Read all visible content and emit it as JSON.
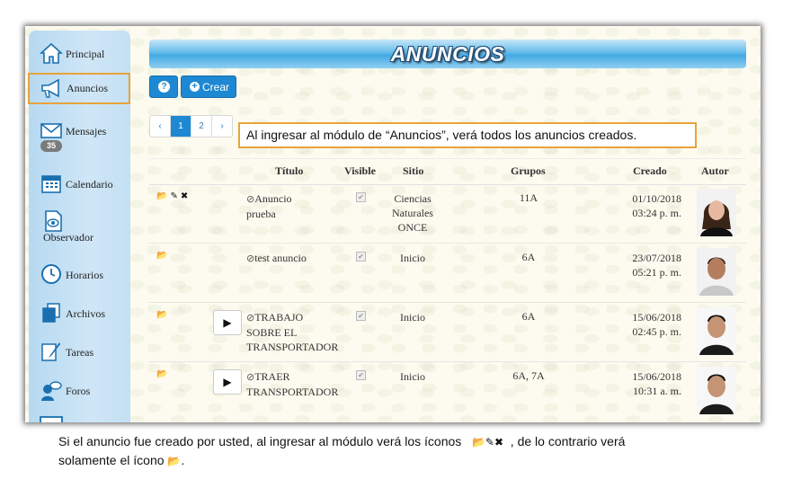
{
  "sidebar": {
    "items": [
      {
        "label": "Principal",
        "icon": "home-icon"
      },
      {
        "label": "Anuncios",
        "icon": "megaphone-icon"
      },
      {
        "label": "Mensajes",
        "icon": "envelope-icon",
        "badge": "35"
      },
      {
        "label": "Calendario",
        "icon": "calendar-icon"
      },
      {
        "label": "Observador",
        "icon": "eye-document-icon"
      },
      {
        "label": "Horarios",
        "icon": "clock-icon"
      },
      {
        "label": "Archivos",
        "icon": "files-icon"
      },
      {
        "label": "Tareas",
        "icon": "pencil-paper-icon"
      },
      {
        "label": "Foros",
        "icon": "forum-icon"
      }
    ]
  },
  "header": {
    "title": "ANUNCIOS"
  },
  "toolbar": {
    "help_label": "?",
    "create_label": "Crear"
  },
  "pager": {
    "prev": "‹",
    "pages": [
      "1",
      "2"
    ],
    "next": "›",
    "active": "1"
  },
  "callout": "Al ingresar al módulo de “Anuncios”, verá todos los anuncios creados.",
  "table": {
    "columns": [
      "Título",
      "Visible",
      "Sitio",
      "Grupos",
      "Creado",
      "Autor"
    ],
    "rows": [
      {
        "title_lines": [
          "Anuncio",
          "prueba"
        ],
        "sitio_lines": [
          "Ciencias",
          "Naturales",
          "ONCE"
        ],
        "grupos": "11A",
        "fecha": "01/10/2018",
        "hora": "03:24 p. m.",
        "actions": "full",
        "play": false
      },
      {
        "title_lines": [
          "test anuncio"
        ],
        "sitio_lines": [
          "Inicio"
        ],
        "grupos": "6A",
        "fecha": "23/07/2018",
        "hora": "05:21 p. m.",
        "actions": "folder",
        "play": false
      },
      {
        "title_lines": [
          "TRABAJO",
          "SOBRE EL",
          "TRANSPORTADOR"
        ],
        "sitio_lines": [
          "Inicio"
        ],
        "grupos": "6A",
        "fecha": "15/06/2018",
        "hora": "02:45 p. m.",
        "actions": "folder",
        "play": true
      },
      {
        "title_lines": [
          "TRAER",
          "TRANSPORTADOR"
        ],
        "sitio_lines": [
          "Inicio"
        ],
        "grupos": "6A, 7A",
        "fecha": "15/06/2018",
        "hora": "10:31 a. m.",
        "actions": "folder",
        "play": true
      }
    ]
  },
  "caption": {
    "line1_before": "Si el anuncio fue creado por usted, al ingresar al módulo verá los íconos",
    "line1_after": ", de lo contrario verá",
    "line2_before": "solamente el ícono",
    "line2_after": "."
  },
  "colors": {
    "accent": "#1e88d2",
    "highlight": "#e8a33a",
    "sidebar": "#c4e0f3"
  }
}
